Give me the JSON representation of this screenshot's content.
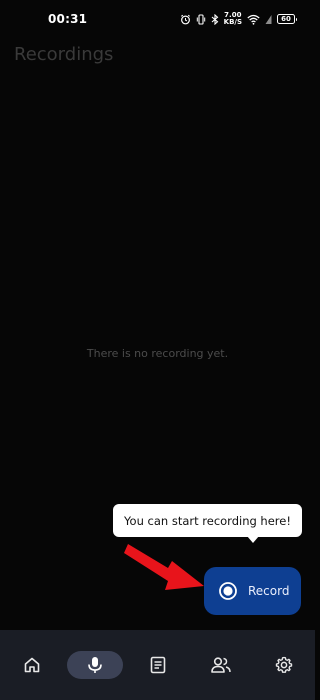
{
  "status_bar": {
    "time": "00:31",
    "net_speed_value": "7.00",
    "net_speed_unit": "KB/S",
    "battery": "60"
  },
  "header": {
    "title": "Recordings"
  },
  "main": {
    "empty_message": "There is no recording yet."
  },
  "tooltip": {
    "text": "You can start recording here!"
  },
  "record_button": {
    "label": "Record",
    "icon": "record-icon",
    "color": "#0e3f92"
  },
  "annotation": {
    "arrow_color": "#e8141b"
  },
  "bottom_nav": {
    "items": [
      {
        "icon": "home-icon",
        "active": false
      },
      {
        "icon": "microphone-icon",
        "active": true
      },
      {
        "icon": "document-icon",
        "active": false
      },
      {
        "icon": "people-icon",
        "active": false
      },
      {
        "icon": "gear-icon",
        "active": false
      }
    ]
  }
}
